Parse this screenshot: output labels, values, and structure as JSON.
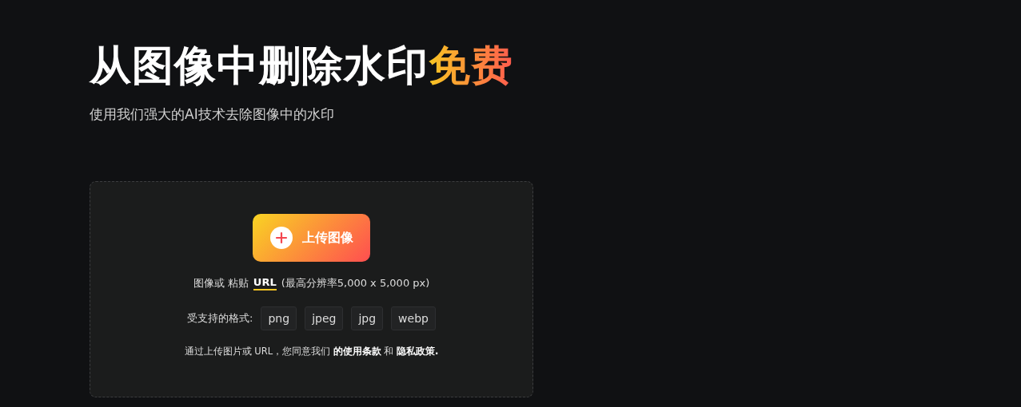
{
  "heading": {
    "title": "从图像中删除水印",
    "highlight": "免费"
  },
  "subtitle": "使用我们强大的AI技术去除图像中的水印",
  "upload": {
    "button": "上传图像",
    "prefix": "图像或 粘贴",
    "url_link": "URL",
    "limit": "(最高分辨率5,000 x 5,000 px)",
    "formats_label": "受支持的格式:",
    "formats": [
      "png",
      "jpeg",
      "jpg",
      "webp"
    ],
    "terms": {
      "text": "通过上传图片或 URL，您同意我们",
      "terms_link": "的使用条款",
      "joiner": "和",
      "privacy_link": "隐私政策."
    }
  }
}
